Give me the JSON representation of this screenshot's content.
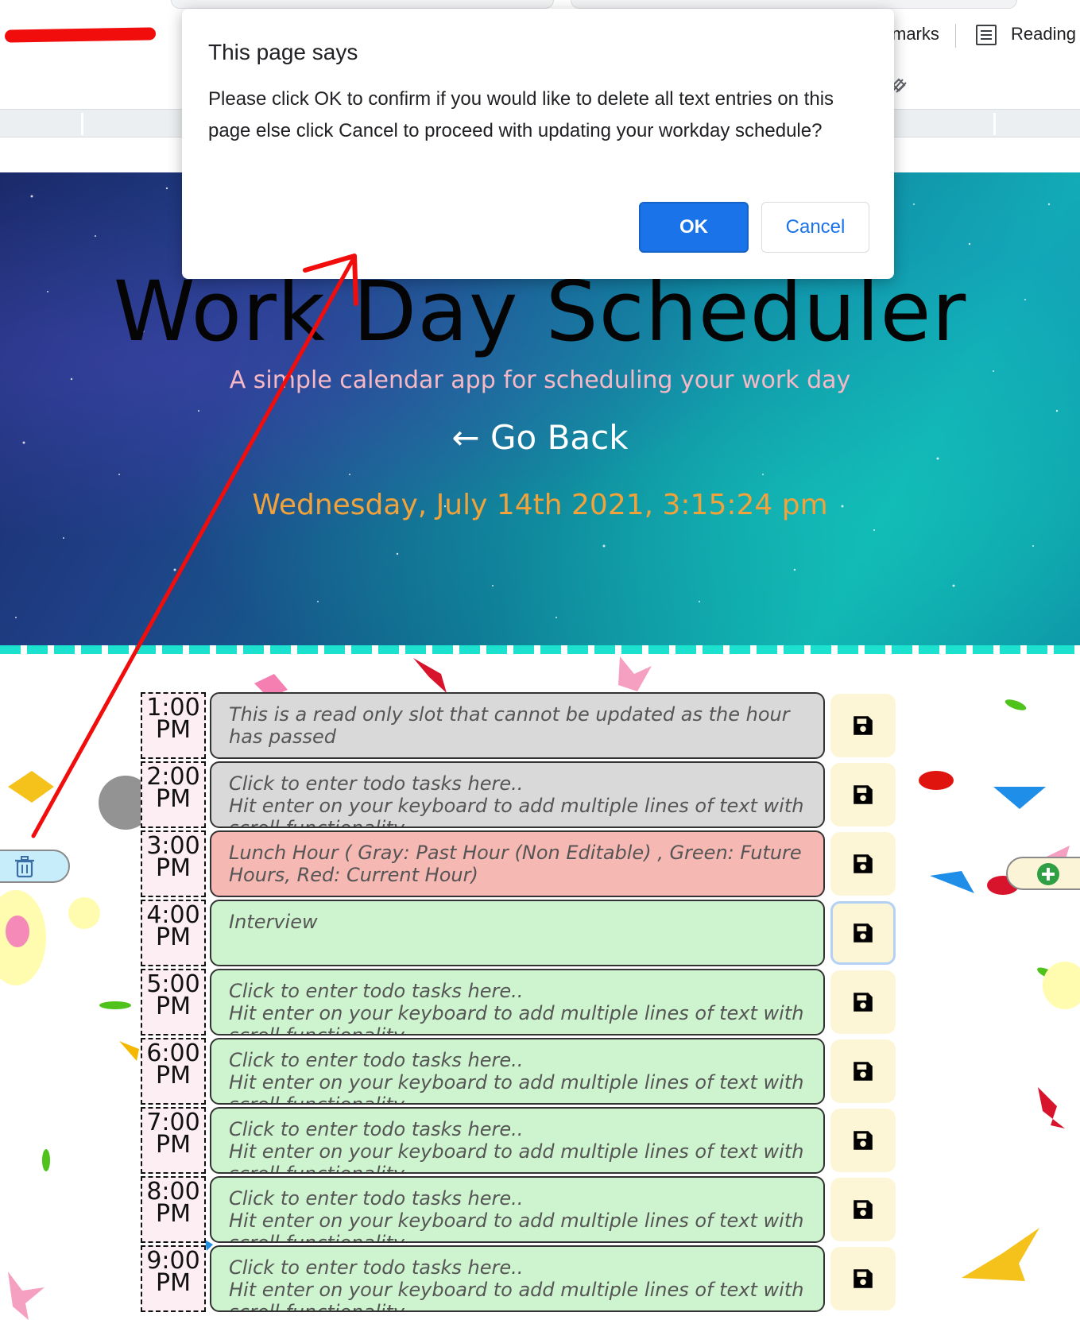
{
  "browser": {
    "bookmark_partial": "marks",
    "reading_list_label": "Reading"
  },
  "hero": {
    "title": "Work Day Scheduler",
    "subtitle": "A simple calendar app for scheduling your work day",
    "back_link": "← Go Back",
    "current_datetime": "Wednesday, July 14th 2021, 3:15:24 pm"
  },
  "schedule": {
    "rows": [
      {
        "hour": "1:00",
        "ampm": "PM",
        "state": "past",
        "text": "This is a read only slot that cannot be updated as the hour has passed"
      },
      {
        "hour": "2:00",
        "ampm": "PM",
        "state": "past",
        "text": "Click to enter todo tasks here..\n Hit enter on your keyboard to add multiple lines of text with scroll functionality"
      },
      {
        "hour": "3:00",
        "ampm": "PM",
        "state": "present",
        "text": "Lunch Hour ( Gray: Past Hour (Non Editable) , Green: Future Hours, Red: Current Hour)"
      },
      {
        "hour": "4:00",
        "ampm": "PM",
        "state": "future",
        "text": "Interview"
      },
      {
        "hour": "5:00",
        "ampm": "PM",
        "state": "future",
        "text": "Click to enter todo tasks here..\n Hit enter on your keyboard to add multiple lines of text with scroll functionality"
      },
      {
        "hour": "6:00",
        "ampm": "PM",
        "state": "future",
        "text": "Click to enter todo tasks here..\n Hit enter on your keyboard to add multiple lines of text with scroll functionality"
      },
      {
        "hour": "7:00",
        "ampm": "PM",
        "state": "future",
        "text": "Click to enter todo tasks here..\n Hit enter on your keyboard to add multiple lines of text with scroll functionality"
      },
      {
        "hour": "8:00",
        "ampm": "PM",
        "state": "future",
        "text": "Click to enter todo tasks here..\n Hit enter on your keyboard to add multiple lines of text with scroll functionality"
      },
      {
        "hour": "9:00",
        "ampm": "PM",
        "state": "future",
        "text": "Click to enter todo tasks here..\n Hit enter on your keyboard to add multiple lines of text with scroll functionality"
      }
    ]
  },
  "dialog": {
    "title": "This page says",
    "message": "Please click OK to confirm if you would like to delete all text entries on this page else click Cancel to proceed with updating your workday schedule?",
    "ok_label": "OK",
    "cancel_label": "Cancel"
  },
  "colors": {
    "past": "#d9d9d9",
    "present": "#f5b8b3",
    "future": "#cdf4ce",
    "ok_button": "#1a73e8",
    "annotation_arrow": "#f20d0d"
  },
  "icons": {
    "save": "floppy-disk-icon",
    "delete_all": "trash-icon",
    "add": "plus-circle-icon",
    "reading_list": "reading-list-icon"
  }
}
